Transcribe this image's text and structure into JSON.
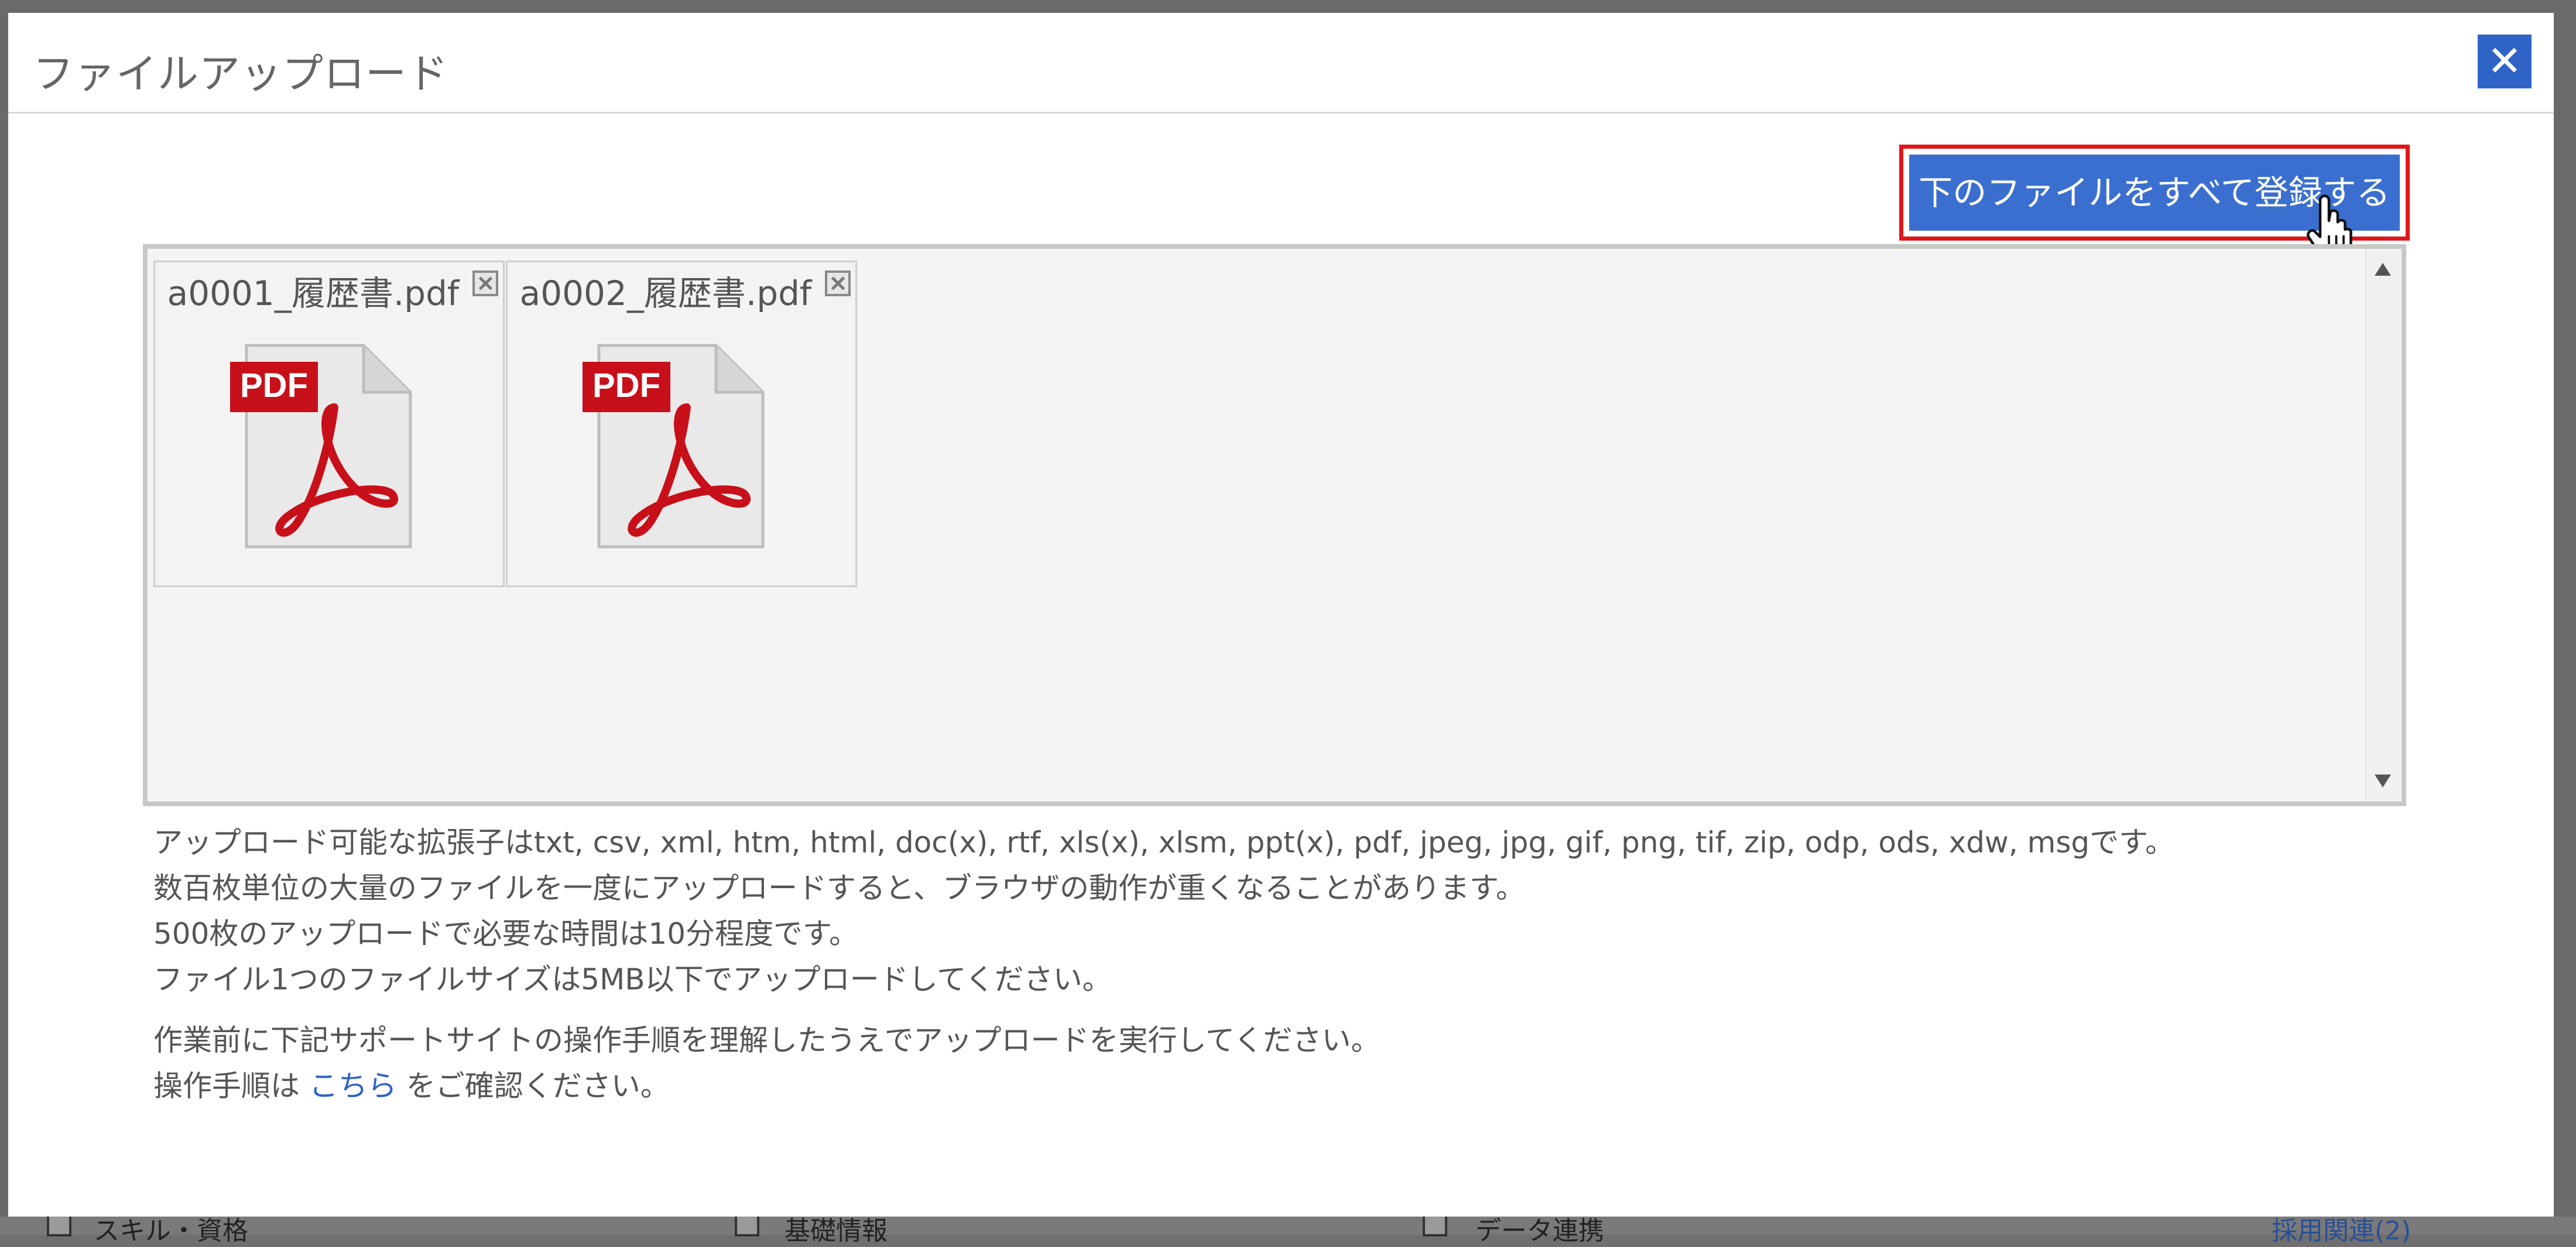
{
  "background": {
    "footer_items": [
      "スキル・資格",
      "基礎情報",
      "データ連携",
      "採用関連(2)"
    ]
  },
  "modal": {
    "title": "ファイルアップロード",
    "close_symbol": "✕",
    "register_button": "下のファイルをすべて登録する",
    "files": [
      {
        "name": "a0001_履歴書.pdf",
        "icon": "pdf-icon",
        "badge": "PDF"
      },
      {
        "name": "a0002_履歴書.pdf",
        "icon": "pdf-icon",
        "badge": "PDF"
      }
    ],
    "notes": [
      "アップロード可能な拡張子はtxt, csv, xml, htm, html, doc(x), rtf, xls(x), xlsm, ppt(x), pdf, jpeg, jpg, gif, png, tif, zip, odp, ods, xdw, msgです。",
      "数百枚単位の大量のファイルを一度にアップロードすると、ブラウザの動作が重くなることがあります。",
      "500枚のアップロードで必要な時間は10分程度です。",
      "ファイル1つのファイルサイズは5MB以下でアップロードしてください。"
    ],
    "support_note": "作業前に下記サポートサイトの操作手順を理解したうえでアップロードを実行してください。",
    "procedure_prefix": "操作手順は",
    "procedure_link": "こちら",
    "procedure_suffix": "をご確認ください。"
  },
  "colors": {
    "primary": "#3a6fd0",
    "highlight_border": "#e2151b",
    "pdf_red": "#c8101a"
  }
}
